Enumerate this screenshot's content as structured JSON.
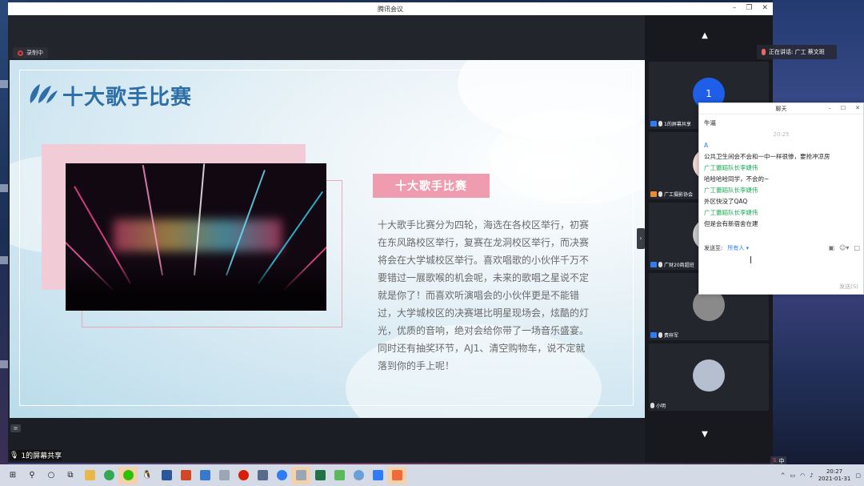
{
  "window": {
    "title": "腾讯会议"
  },
  "recording": {
    "label": "录制中"
  },
  "slide": {
    "title": "十大歌手比赛",
    "tag": "十大歌手比赛",
    "paragraph": "十大歌手比赛分为四轮，海选在各校区举行，初赛在东风路校区举行，复赛在龙洞校区举行，而决赛将会在大学城校区举行。喜欢唱歌的小伙伴千万不要错过一展歌喉的机会呢，未来的歌唱之星说不定就是你了！而喜欢听演唱会的小伙伴更是不能错过，大学城校区的决赛堪比明星现场会，炫酷的灯光，优质的音响，绝对会给你带了一场音乐盛宴。同时还有抽奖环节，AJ1、清空购物车，说不定就落到你的手上呢！"
  },
  "share_label": "1的屏幕共享",
  "speaking": {
    "label": "正在讲话: 广工 蔡文斑"
  },
  "participants": [
    {
      "name": "1的屏幕共享",
      "avatar_text": "1"
    },
    {
      "name": "广工摄影协会"
    },
    {
      "name": "广财20商超班"
    },
    {
      "name": "费梓军"
    },
    {
      "name": "小明"
    }
  ],
  "chat": {
    "title": "聊天",
    "messages": [
      {
        "sender": "",
        "text": "牛逼",
        "sender_color": ""
      },
      {
        "time": "20:25"
      },
      {
        "sender": "A",
        "text": "公共卫生间会不会和一中一样很惨，要抢冲凉房",
        "sender_color": "#2e7cf6"
      },
      {
        "sender": "广工蕾蹈队长李婕伟",
        "text": "哈哈哈哈同学，不会的~",
        "sender_color": "#1aaa55"
      },
      {
        "sender": "广工蕾蹈队长李婕伟",
        "text": "外区快没了QAQ",
        "sender_color": "#1aaa55"
      },
      {
        "sender": "广工蕾蹈队长李婕伟",
        "text": "但是会有新宿舍在建",
        "sender_color": "#1aaa55"
      }
    ],
    "send_to_label": "发送至:",
    "send_to_value": "所有人",
    "send_button": "发送(S)"
  },
  "taskbar": {
    "time": "20:27",
    "date": "2021-01-31",
    "ime": "中"
  },
  "colors": {
    "accent": "#2e7cf6",
    "slide_title": "#2e6fa7",
    "tag": "#ef9bb0"
  }
}
